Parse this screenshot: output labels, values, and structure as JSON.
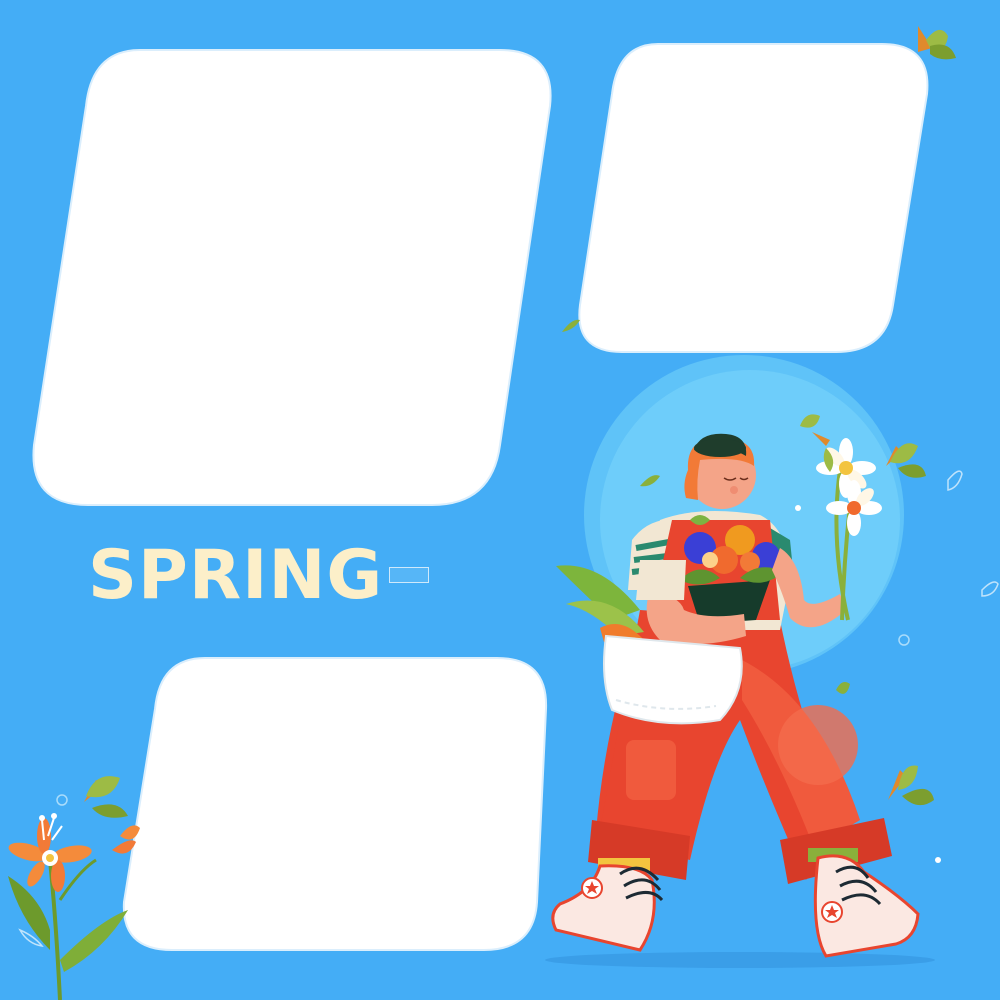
{
  "title": "SPRING",
  "colors": {
    "background": "#44adf6",
    "frame": "#ffffff",
    "title_text": "#fcefc9",
    "circle_outer": "#5fc3f8",
    "circle_inner": "#7ad5fb",
    "overalls": "#e8452f",
    "hair": "#f27a37",
    "leaf": "#8ab03b"
  },
  "photo_frames": [
    {
      "name": "photo-frame-large"
    },
    {
      "name": "photo-frame-top-right"
    },
    {
      "name": "photo-frame-bottom"
    }
  ],
  "illustration": {
    "subject": "woman-walking-with-flowers-icon",
    "decorations": [
      "flower-stem-icon",
      "falling-leaf-icon",
      "daisy-bouquet-icon",
      "tote-bag-icon",
      "sneaker-icon"
    ]
  }
}
